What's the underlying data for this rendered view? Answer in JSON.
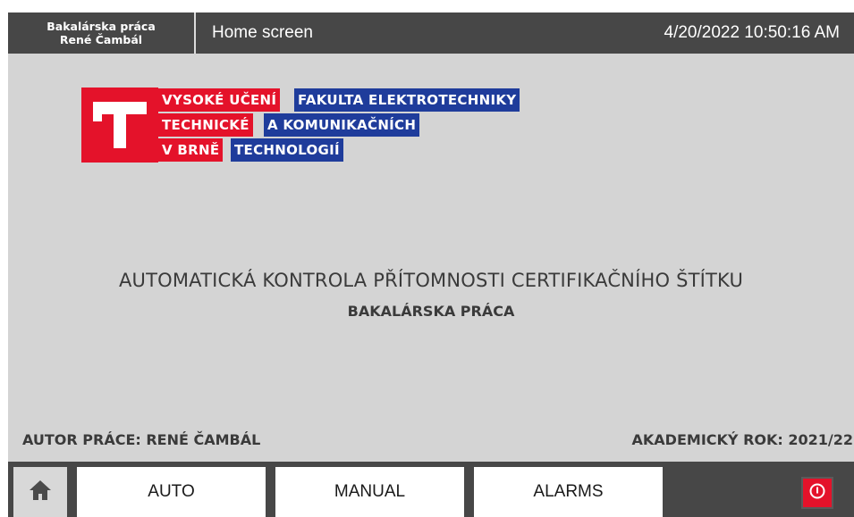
{
  "header": {
    "project_line1": "Bakalárska práca",
    "project_line2": "René Čambál",
    "screen_name": "Home screen",
    "datetime": "4/20/2022 10:50:16 AM"
  },
  "logo": {
    "row1_left": "VYSOKÉ UČENÍ",
    "row1_right": "FAKULTA ELEKTROTECHNIKY",
    "row2_left": "TECHNICKÉ",
    "row2_right": "A KOMUNIKAČNÍCH",
    "row3_left": "V BRNĚ",
    "row3_right": "TECHNOLOGIÍ",
    "colors": {
      "red": "#e4122a",
      "blue": "#1f3c9b"
    }
  },
  "main": {
    "title": "AUTOMATICKÁ KONTROLA PŘÍTOMNOSTI CERTIFIKAČNÍHO ŠTÍTKU",
    "subtitle": "BAKALÁRSKA PRÁCA",
    "author": "AUTOR PRÁCE: RENÉ ČAMBÁL",
    "year": "AKADEMICKÝ ROK: 2021/22"
  },
  "footer": {
    "home_icon": "home-icon",
    "buttons": [
      "AUTO",
      "MANUAL",
      "ALARMS"
    ],
    "power_icon": "power-icon"
  }
}
